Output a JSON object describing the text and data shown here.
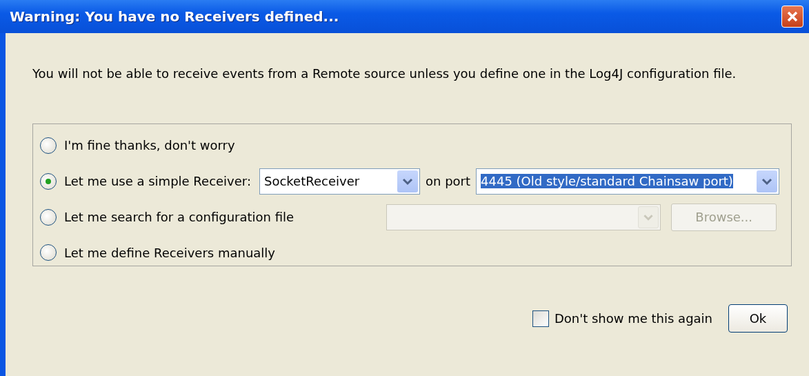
{
  "window": {
    "title": "Warning: You have no Receivers defined..."
  },
  "message": "You will not be able to receive events from a Remote source unless you define one in the Log4J configuration file.",
  "options": [
    {
      "kind": "plain",
      "label": "I'm fine thanks, don't worry",
      "selected": false
    },
    {
      "kind": "receiver",
      "label": "Let me use a simple Receiver:",
      "selected": true,
      "receiver_select": {
        "value": "SocketReceiver"
      },
      "port_label": "on port",
      "port_select": {
        "value": "4445 (Old style/standard Chainsaw port)",
        "text_selected": true
      }
    },
    {
      "kind": "file",
      "label": "Let me search for a configuration file",
      "selected": false,
      "file_select": {
        "disabled": true
      },
      "browse_button": {
        "label": "Browse...",
        "disabled": true
      }
    },
    {
      "kind": "plain",
      "label": "Let me define Receivers manually",
      "selected": false
    }
  ],
  "dont_show_again": {
    "label": "Don't show me this again",
    "checked": false
  },
  "ok_button": {
    "label": "Ok"
  }
}
